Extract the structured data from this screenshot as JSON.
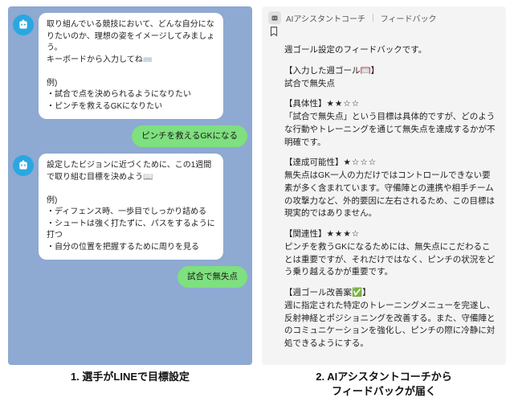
{
  "left": {
    "bot1": "取り組んでいる競技において、どんな自分になりたいのか、理想の姿をイメージしてみましょう。\nキーボードから入力してね⌨️\n\n例)\n・試合で点を決められるようになりたい\n・ピンチを救えるGKになりたい",
    "user1": "ピンチを救えるGKになる",
    "bot2": "設定したビジョンに近づくために、この1週間で取り組む目標を決めよう📖\n\n例)\n・ディフェンス時、一歩目でしっかり詰める\n・シュートは強く打たずに、パスをするように打つ\n・自分の位置を把握するために周りを見る",
    "user2": "試合で無失点"
  },
  "right": {
    "app_name": "AIアシスタントコーチ",
    "header_sub": "フィードバック",
    "intro": "週ゴール設定のフィードバックです。",
    "goal_label": "【入力した週ゴール🥅】",
    "goal_value": "試合で無失点",
    "s1_label": "【具体性】",
    "s1_stars": "★★☆☆",
    "s1_text": "「試合で無失点」という目標は具体的ですが、どのような行動やトレーニングを通じて無失点を達成するかが不明確です。",
    "s2_label": "【達成可能性】",
    "s2_stars": "★☆☆☆",
    "s2_text": "無失点はGK一人の力だけではコントロールできない要素が多く含まれています。守備陣との連携や相手チームの攻撃力など、外的要因に左右されるため、この目標は現実的ではありません。",
    "s3_label": "【関連性】",
    "s3_stars": "★★★☆",
    "s3_text": "ピンチを救うGKになるためには、無失点にこだわることは重要ですが、それだけではなく、ピンチの状況をどう乗り越えるかが重要です。",
    "s4_label": "【週ゴール改善案✅】",
    "s4_text": "週に指定された特定のトレーニングメニューを完遂し、反射神経とポジショニングを改善する。また、守備陣とのコミュニケーションを強化し、ピンチの際に冷静に対処できるようにする。"
  },
  "captions": {
    "left": "1. 選手がLINEで目標設定",
    "right": "2. AIアシスタントコーチから\nフィードバックが届く"
  }
}
